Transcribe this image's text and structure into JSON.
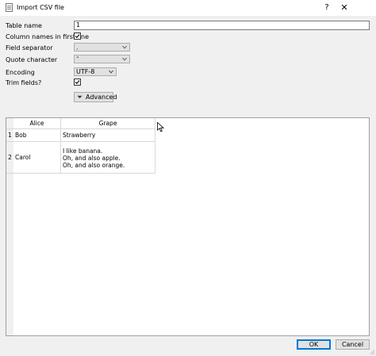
{
  "window": {
    "title": "Import CSV file",
    "help_label": "?",
    "close_label": "✕"
  },
  "form": {
    "table_name_label": "Table name",
    "table_name_value": "1",
    "column_names_label": "Column names in first line",
    "column_names_checked": true,
    "field_separator_label": "Field separator",
    "field_separator_value": ",",
    "quote_character_label": "Quote character",
    "quote_character_value": "\"",
    "encoding_label": "Encoding",
    "encoding_value": "UTF-8",
    "trim_fields_label": "Trim fields?",
    "trim_fields_checked": true,
    "advanced_label": "Advanced"
  },
  "preview": {
    "columns": [
      "Alice",
      "Grape"
    ],
    "rows": [
      {
        "num": "1",
        "cells": [
          "Bob",
          "Strawberry"
        ]
      },
      {
        "num": "2",
        "cells": [
          "Carol",
          "I like banana.\nOh, and also apple.\nOh, and also orange."
        ]
      }
    ],
    "row2_lines": [
      "I like banana.",
      "Oh, and also apple.",
      "Oh, and also orange."
    ]
  },
  "buttons": {
    "ok": "OK",
    "cancel": "Cancel"
  }
}
